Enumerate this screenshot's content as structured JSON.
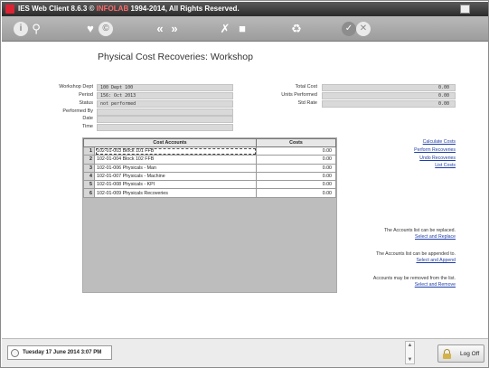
{
  "window": {
    "title": "IES Web Client 8.6.3 © ",
    "title_brand": "INFOLAB",
    "title_suffix": " 1994-2014, All Rights Reserved."
  },
  "toolbar": {
    "icons": [
      "info-icon",
      "search-icon",
      "favorite-heart-icon",
      "copyright-icon",
      "back-icon",
      "forward-icon",
      "tools-icon",
      "stop-icon",
      "recycle-icon",
      "ok-icon",
      "cancel-icon"
    ]
  },
  "page": {
    "title": "Physical Cost Recoveries: Workshop"
  },
  "form_left": {
    "workshop_dept": {
      "label": "Workshop Dept",
      "value": "100 Dept 100"
    },
    "period": {
      "label": "Period",
      "value": "156: Oct 2013"
    },
    "status": {
      "label": "Status",
      "value": "not performed"
    },
    "performed_by": {
      "label": "Performed By",
      "value": ""
    },
    "date": {
      "label": "Date",
      "value": ""
    },
    "time": {
      "label": "Time",
      "value": ""
    }
  },
  "form_right": {
    "total_cost": {
      "label": "Total Cost",
      "value": "0.00"
    },
    "units_performed": {
      "label": "Units Performed",
      "value": "0.00"
    },
    "std_rate": {
      "label": "Std Rate",
      "value": "0.00"
    }
  },
  "grid": {
    "headers": {
      "accounts": "Cost Accounts",
      "costs": "Costs"
    },
    "rows": [
      {
        "num": "1",
        "account": "102-01-003 Block 101 FFB",
        "cost": "0.00"
      },
      {
        "num": "2",
        "account": "102-01-004 Block 102 FFB",
        "cost": "0.00"
      },
      {
        "num": "3",
        "account": "102-01-006 Physicals - Man",
        "cost": "0.00"
      },
      {
        "num": "4",
        "account": "102-01-007 Physicals - Machine",
        "cost": "0.00"
      },
      {
        "num": "5",
        "account": "102-01-008 Physicals - KPI",
        "cost": "0.00"
      },
      {
        "num": "6",
        "account": "102-01-009 Physicals Recoveries",
        "cost": "0.00"
      }
    ]
  },
  "actions": {
    "calculate_costs": "Calculate Costs",
    "perform_recoveries": "Perform Recoveries",
    "undo_recoveries": "Undo Recoveries",
    "list_costs": "List Costs"
  },
  "notes": {
    "replace_text": "The Accounts list can be replaced.",
    "replace_link": "Select and Replace",
    "append_text": "The Accounts list can be appended to.",
    "append_link": "Select and Append",
    "remove_text": "Accounts may be removed from the list.",
    "remove_link": "Select and Remove"
  },
  "statusbar": {
    "datetime": "Tuesday 17 June 2014 3:07 PM",
    "logoff_label": "Log Off"
  }
}
